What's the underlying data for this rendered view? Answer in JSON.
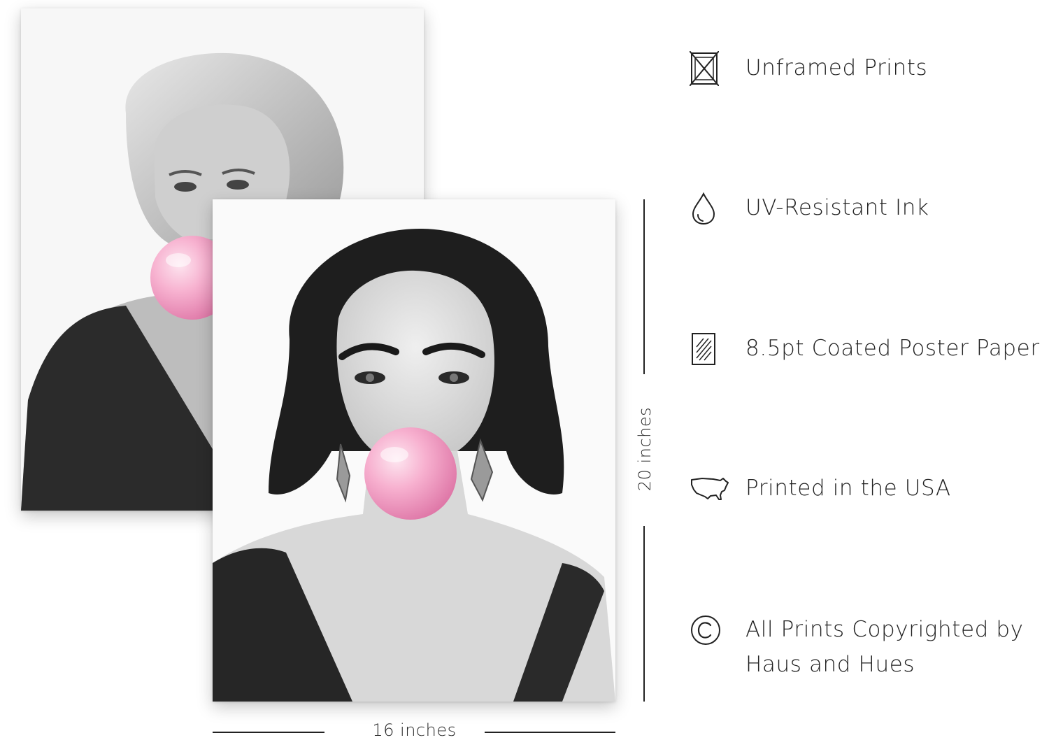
{
  "dimensions": {
    "width_label": "16 inches",
    "height_label": "20 inches"
  },
  "features": [
    {
      "icon": "unframed-frame-icon",
      "label": "Unframed Prints"
    },
    {
      "icon": "ink-drop-icon",
      "label": "UV-Resistant Ink"
    },
    {
      "icon": "coated-paper-icon",
      "label": "8.5pt Coated Poster Paper"
    },
    {
      "icon": "usa-map-icon",
      "label": "Printed in the USA"
    },
    {
      "icon": "copyright-icon",
      "label": "All Prints Copyrighted by Haus and Hues"
    }
  ],
  "colors": {
    "bubble_pink": "#f5a3c7",
    "text": "#222222",
    "print_background": "#fafafa"
  }
}
